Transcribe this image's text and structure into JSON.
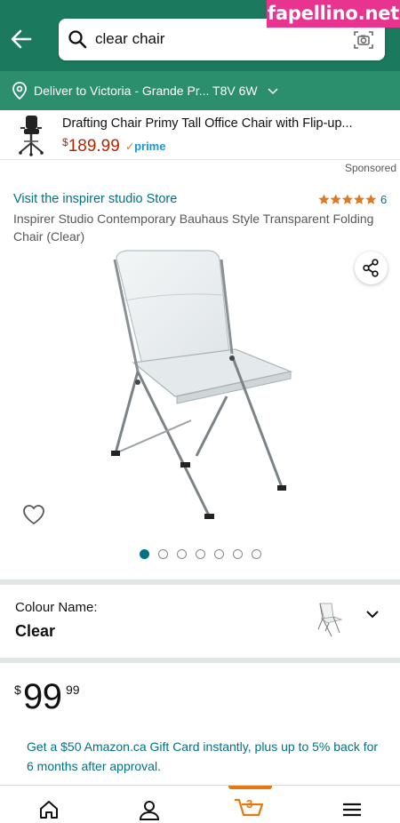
{
  "watermark": "fapellino.net",
  "search": {
    "query": "clear chair"
  },
  "deliver": {
    "text": "Deliver to Victoria - Grande Pr... T8V 6W"
  },
  "ad": {
    "title": "Drafting Chair Primy Tall Office Chair with Flip-up...",
    "price_currency": "$",
    "price_value": "189.99",
    "prime_check": "✓",
    "prime_label": "prime",
    "sponsored": "Sponsored"
  },
  "product": {
    "store_link": "Visit the inspirer studio Store",
    "rating_count": "6",
    "rating_stars": 5,
    "title": "Inspirer Studio Contemporary Bauhaus Style Transparent Folding Chair (Clear)",
    "image_count": 7,
    "active_image": 1
  },
  "colour": {
    "label": "Colour Name:",
    "value": "Clear"
  },
  "price": {
    "currency": "$",
    "whole": "99",
    "fraction": "99"
  },
  "gift": {
    "text": "Get a $50 Amazon.ca Gift Card instantly, plus up to 5% back for 6 months after approval."
  },
  "cart": {
    "count": "3"
  },
  "colors": {
    "header": "#1b7a5e",
    "deliver_bar": "#2b8f6e",
    "link": "#007185",
    "price_red": "#b12704",
    "star": "#de7921",
    "cart_accent": "#e47911",
    "watermark": "#e8338f"
  },
  "icons": [
    "back-arrow-icon",
    "search-icon",
    "camera-icon",
    "location-pin-icon",
    "chevron-down-icon",
    "share-icon",
    "heart-icon",
    "home-icon",
    "account-icon",
    "cart-icon",
    "menu-icon"
  ]
}
